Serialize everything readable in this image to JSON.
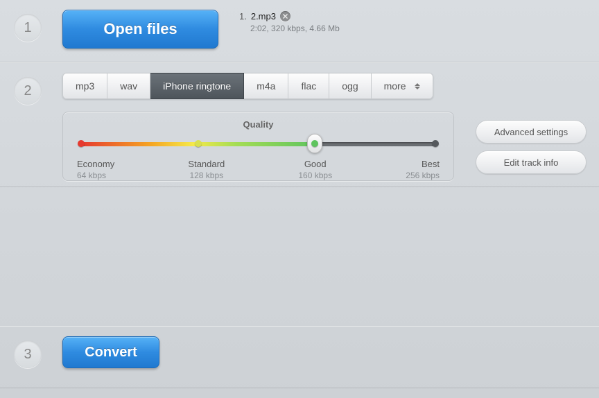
{
  "step1": {
    "number": "1",
    "button_label": "Open files",
    "file": {
      "index": "1.",
      "name": "2.mp3",
      "meta": "2:02, 320 kbps, 4.66 Mb"
    }
  },
  "step2": {
    "number": "2",
    "formats": [
      {
        "label": "mp3",
        "active": false
      },
      {
        "label": "wav",
        "active": false
      },
      {
        "label": "iPhone ringtone",
        "active": true
      },
      {
        "label": "m4a",
        "active": false
      },
      {
        "label": "flac",
        "active": false
      },
      {
        "label": "ogg",
        "active": false
      },
      {
        "label": "more",
        "active": false,
        "more": true
      }
    ],
    "quality": {
      "title": "Quality",
      "thumb_percent": 66,
      "stops": [
        {
          "label": "Economy",
          "sub": "64 kbps",
          "percent": 0,
          "color": "#e63a2f"
        },
        {
          "label": "Standard",
          "sub": "128 kbps",
          "percent": 33,
          "color": "#d9e050"
        },
        {
          "label": "Good",
          "sub": "160 kbps",
          "percent": 66,
          "color": "#5fc45f"
        },
        {
          "label": "Best",
          "sub": "256 kbps",
          "percent": 100,
          "color": "#55595d"
        }
      ]
    },
    "side": {
      "advanced": "Advanced settings",
      "edit_info": "Edit track info"
    }
  },
  "step3": {
    "number": "3",
    "button_label": "Convert"
  }
}
